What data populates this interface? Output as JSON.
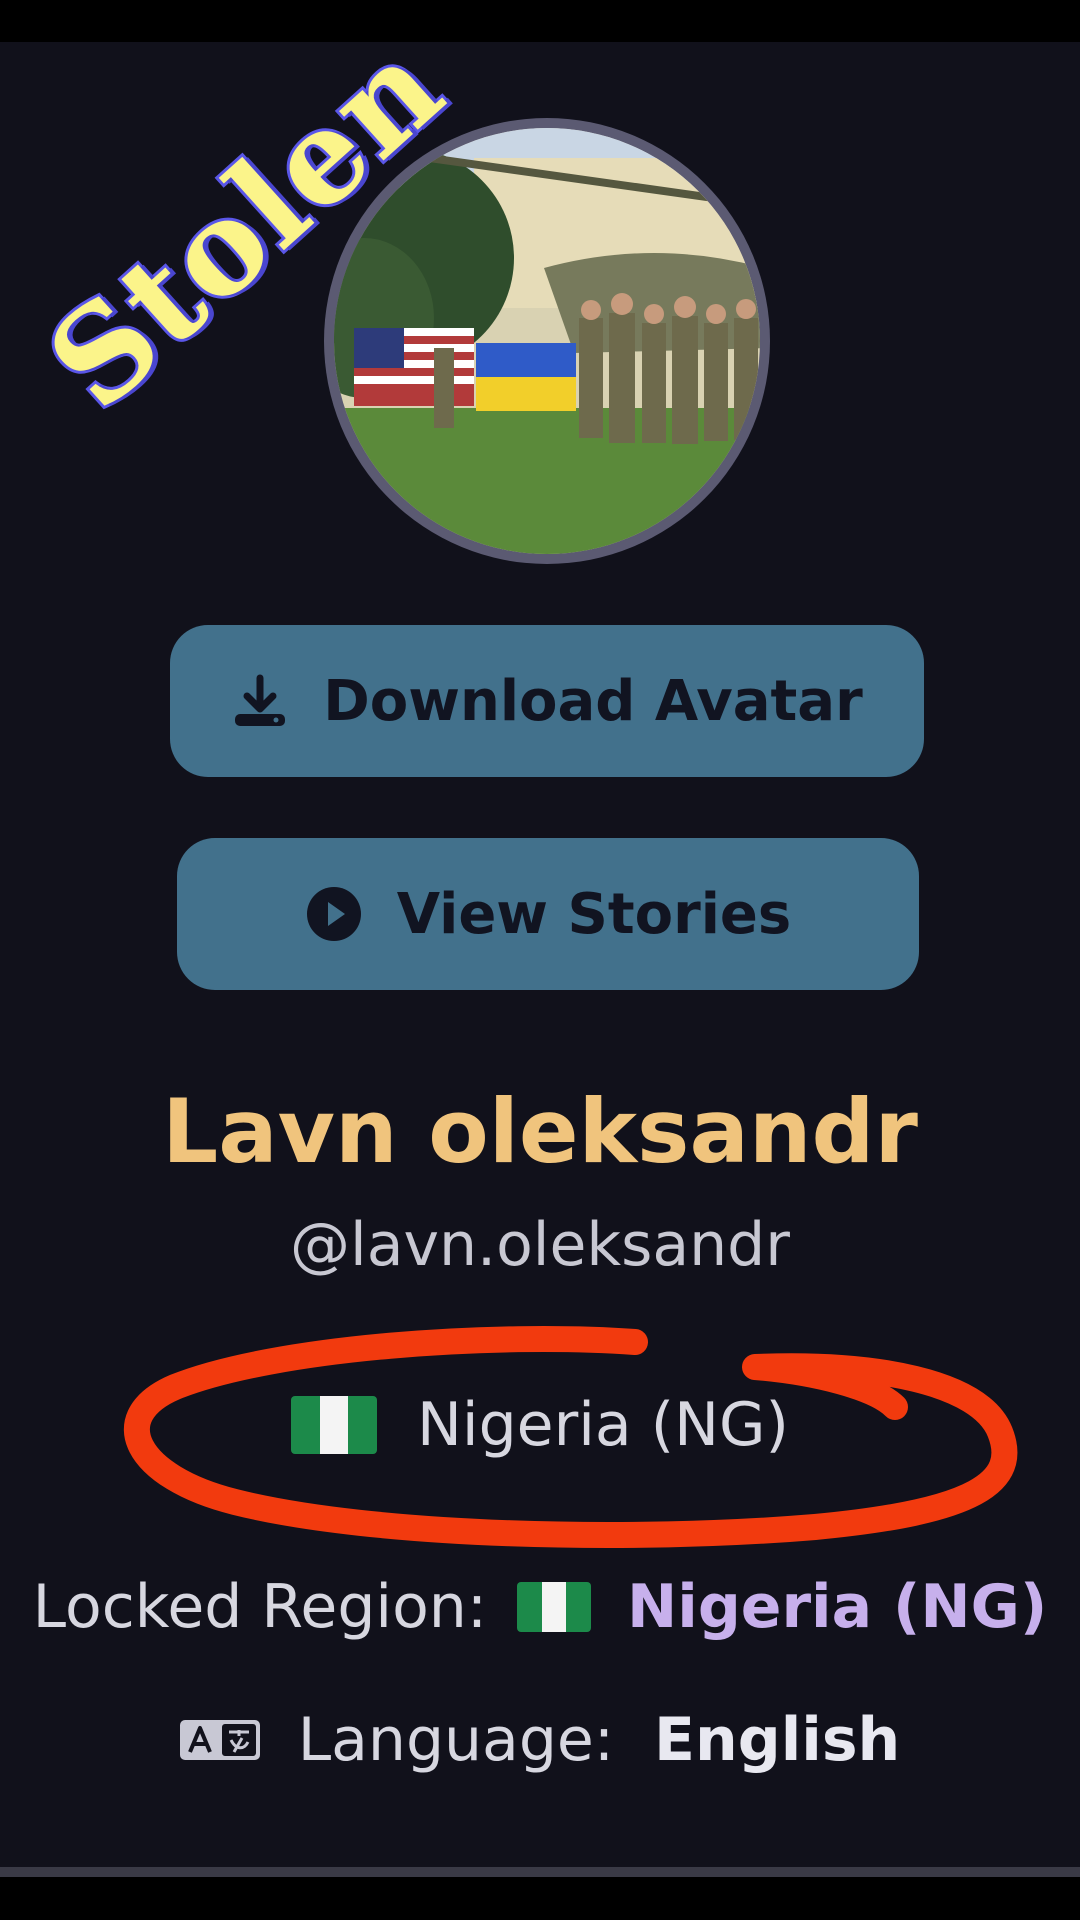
{
  "watermark": {
    "text": "Stolen",
    "fill_color": "#fbf48a",
    "stroke_color": "#5a56e8"
  },
  "avatar": {
    "description_icon": "profile-photo"
  },
  "buttons": {
    "download": {
      "label": "Download Avatar",
      "icon": "download-icon"
    },
    "stories": {
      "label": "View Stories",
      "icon": "play-circle-icon"
    }
  },
  "profile": {
    "display_name": "Lavn oleksandr",
    "username": "@lavn.oleksandr",
    "country": "Nigeria (NG)",
    "country_flag": "nigeria-flag-icon"
  },
  "locked_region": {
    "label": "Locked Region:",
    "value": "Nigeria (NG)"
  },
  "language": {
    "label": "Language:",
    "value": "English",
    "icon": "translate-icon"
  },
  "colors": {
    "background": "#11111b",
    "button": "#42718c",
    "name": "#f0c47d",
    "region_value": "#c7b0ec",
    "highlight_circle": "#f23a0e"
  }
}
